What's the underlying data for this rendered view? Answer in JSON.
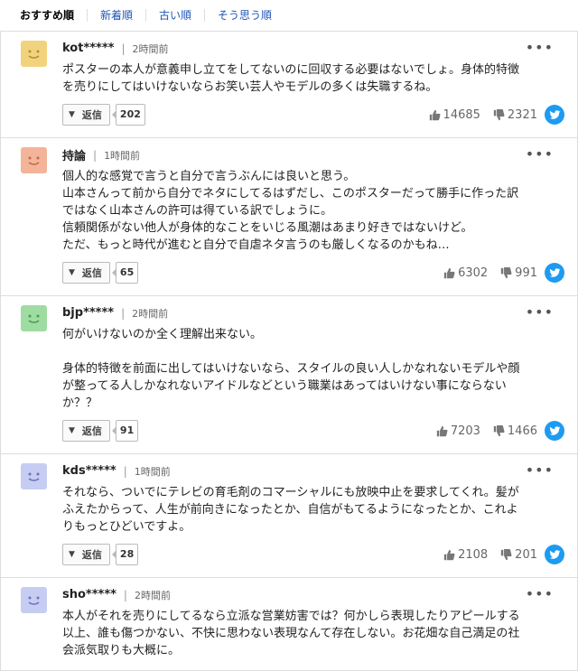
{
  "tabs": [
    "おすすめ順",
    "新着順",
    "古い順",
    "そう思う順"
  ],
  "comments": [
    {
      "user": "kot*****",
      "time": "2時間前",
      "avatar_color": "#f2d37d",
      "text": "ポスターの本人が意義申し立てをしてないのに回収する必要はないでしょ。身体的特徴\nを売りにしてはいけないならお笑い芸人やモデルの多くは失職するね。",
      "reply_label": "返信",
      "reply_count": "202",
      "likes": "14685",
      "dislikes": "2321"
    },
    {
      "user": "持論",
      "time": "1時間前",
      "avatar_color": "#f4b49a",
      "text": "個人的な感覚で言うと自分で言うぶんには良いと思う。\n山本さんって前から自分でネタにしてるはずだし、このポスターだって勝手に作った訳\nではなく山本さんの許可は得ている訳でしょうに。\n信頼関係がない他人が身体的なことをいじる風潮はあまり好きではないけど。\nただ、もっと時代が進むと自分で自虐ネタ言うのも厳しくなるのかもね…",
      "reply_label": "返信",
      "reply_count": "65",
      "likes": "6302",
      "dislikes": "991"
    },
    {
      "user": "bjp*****",
      "time": "2時間前",
      "avatar_color": "#9fdca2",
      "text": "何がいけないのか全く理解出来ない。\n\n身体的特徴を前面に出してはいけないなら、スタイルの良い人しかなれないモデルや顔\nが整ってる人しかなれないアイドルなどという職業はあってはいけない事にならない\nか？？",
      "reply_label": "返信",
      "reply_count": "91",
      "likes": "7203",
      "dislikes": "1466"
    },
    {
      "user": "kds*****",
      "time": "1時間前",
      "avatar_color": "#c7cdf2",
      "text": "それなら、ついでにテレビの育毛剤のコマーシャルにも放映中止を要求してくれ。髪が\nふえたからって、人生が前向きになったとか、自信がもてるようになったとか、これよ\nりもっとひどいですよ。",
      "reply_label": "返信",
      "reply_count": "28",
      "likes": "2108",
      "dislikes": "201"
    },
    {
      "user": "sho*****",
      "time": "2時間前",
      "avatar_color": "#c7cdf2",
      "text": "本人がそれを売りにしてるなら立派な営業妨害では？何かしら表現したりアピールする\n以上、誰も傷つかない、不快に思わない表現なんて存在しない。お花畑な自己満足の社\n会派気取りも大概に。",
      "reply_label": "",
      "reply_count": "",
      "likes": "",
      "dislikes": ""
    }
  ]
}
